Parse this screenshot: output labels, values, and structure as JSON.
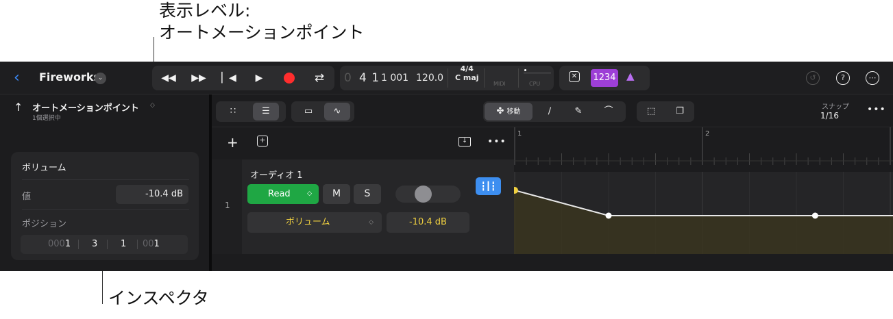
{
  "callouts": {
    "top_line1": "表示レベル:",
    "top_line2": "オートメーションポイント",
    "bottom": "インスペクタ"
  },
  "header": {
    "project_title": "Fireworks"
  },
  "lcd": {
    "position_bar": "4 1",
    "position_ticks": "1 001",
    "tempo": "120.0",
    "time_signature": "4/4",
    "key": "C maj",
    "midi_label": "MIDI",
    "cpu_label": "CPU"
  },
  "count_in": {
    "label": "1234"
  },
  "inspector": {
    "title": "オートメーションポイント",
    "subtitle": "1個選択中",
    "section_title": "ボリューム",
    "value_label": "値",
    "value": "-10.4 dB",
    "position_label": "ポジション",
    "position_segments": [
      {
        "dim": "000",
        "val": "1"
      },
      {
        "dim": "",
        "val": "3"
      },
      {
        "dim": "",
        "val": "1"
      },
      {
        "dim": "00",
        "val": "1"
      }
    ]
  },
  "toolbar": {
    "move_label": "移動",
    "snap_label": "スナップ",
    "snap_value": "1/16"
  },
  "track": {
    "number": "1",
    "name": "オーディオ 1",
    "automation_mode": "Read",
    "mute_label": "M",
    "solo_label": "S",
    "parameter": "ボリューム",
    "parameter_value": "-10.4 dB"
  },
  "timeline": {
    "bars": [
      "1",
      "2"
    ],
    "automation_points": [
      {
        "bar": 1.0,
        "db": -6.0
      },
      {
        "bar": 1.5,
        "db": -10.4
      },
      {
        "bar": 2.6,
        "db": -10.4
      }
    ]
  },
  "colors": {
    "accent_blue": "#3b8cff",
    "record_red": "#ff2d2d",
    "read_green": "#1fa744",
    "count_in_purple": "#9d3fd6",
    "automation_yellow": "#f0d040"
  }
}
